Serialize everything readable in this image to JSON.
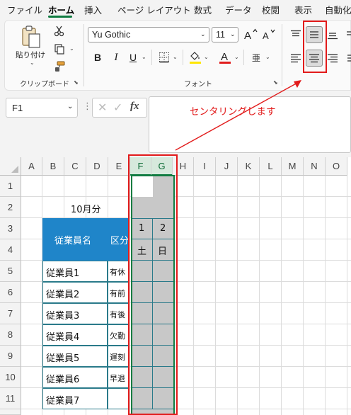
{
  "menu": {
    "items": [
      "ファイル",
      "ホーム",
      "挿入",
      "ページ レイアウト",
      "数式",
      "データ",
      "校閲",
      "表示",
      "自動化"
    ],
    "active": "ホーム"
  },
  "ribbon": {
    "clipboard": {
      "paste_label": "貼り付け",
      "group_label": "クリップボード"
    },
    "font": {
      "font_name": "Yu Gothic",
      "font_size": "11",
      "group_label": "フォント",
      "phonetic_glyph": "亜"
    },
    "icons": [
      "paste-icon",
      "cut-icon",
      "copy-icon",
      "format-painter-icon",
      "grow-font-icon",
      "shrink-font-icon",
      "bold-icon",
      "italic-icon",
      "underline-icon",
      "border-icon",
      "fill-color-icon",
      "font-color-icon",
      "phonetic-icon",
      "align-top-icon",
      "align-middle-icon",
      "align-bottom-icon",
      "align-left-icon",
      "align-center-icon",
      "align-right-icon"
    ]
  },
  "formula_bar": {
    "name_box": "F1",
    "fx": "fx"
  },
  "annotation": {
    "text": "センタリングします",
    "color": "#e21b1b"
  },
  "sheet": {
    "columns": [
      "A",
      "B",
      "C",
      "D",
      "E",
      "F",
      "G",
      "H",
      "I",
      "J",
      "K",
      "L",
      "M",
      "N",
      "O"
    ],
    "selected_columns": [
      "F",
      "G"
    ],
    "rows": [
      "1",
      "2",
      "3",
      "4",
      "5",
      "6",
      "7",
      "8",
      "9",
      "10",
      "11"
    ],
    "title": "10月分",
    "header_employee": "従業員名",
    "header_kubun": "区分",
    "days": [
      "1",
      "2"
    ],
    "weekdays": [
      "土",
      "日"
    ],
    "employees": [
      "従業員1",
      "従業員2",
      "従業員3",
      "従業員4",
      "従業員5",
      "従業員6",
      "従業員7"
    ],
    "kubun": [
      "有休",
      "有前",
      "有後",
      "欠勤",
      "遅刻",
      "早退",
      ""
    ],
    "header_fill": "#1f85c9"
  }
}
